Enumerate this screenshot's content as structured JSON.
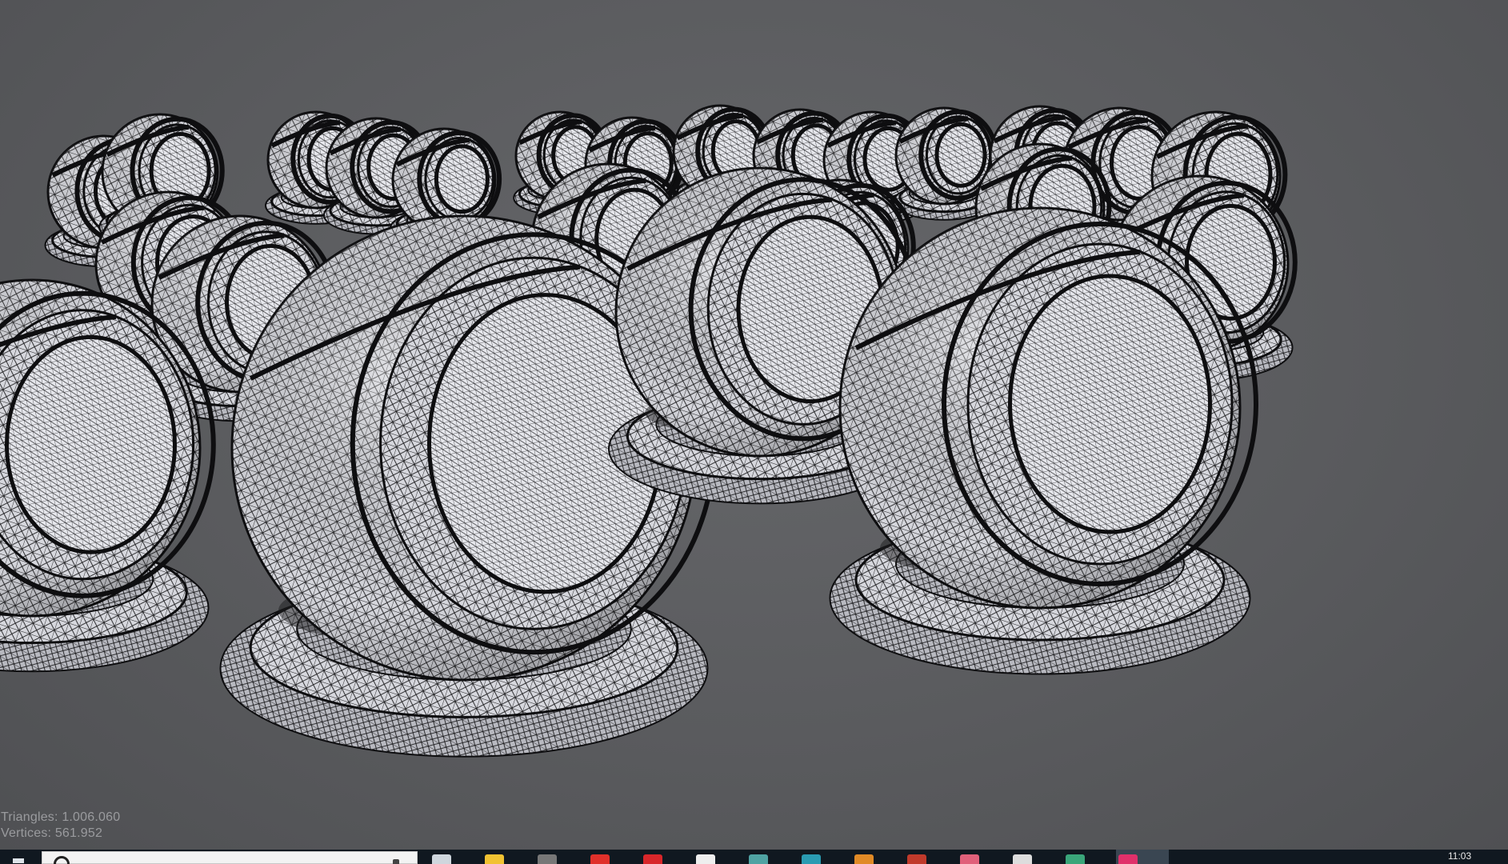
{
  "viewport": {
    "background": "#5a5b5e",
    "wire_color": "#0e0e10",
    "surface_color": "#d8d9df",
    "stats": [
      {
        "label": "Triangles",
        "value": "1.006.060"
      },
      {
        "label": "Vertices",
        "value": "561.952"
      }
    ]
  },
  "taskbar": {
    "background": "#101820",
    "start_icon": "windows-logo-icon",
    "search_icon": "search-icon",
    "mic_icon": "microphone-icon",
    "apps": [
      {
        "name": "task-view-icon",
        "color": "#cfd6dd"
      },
      {
        "name": "folder-icon",
        "color": "#f1c232"
      },
      {
        "name": "settings-icon",
        "color": "#777777"
      },
      {
        "name": "opera-icon",
        "color": "#e0302a"
      },
      {
        "name": "app-red-icon",
        "color": "#d8262a"
      },
      {
        "name": "notepad-icon",
        "color": "#eeeeee"
      },
      {
        "name": "app-teal-icon",
        "color": "#4fa3a3"
      },
      {
        "name": "app-cyan-icon",
        "color": "#2a9bb2"
      },
      {
        "name": "app-orange-icon",
        "color": "#e08a26"
      },
      {
        "name": "app-red2-icon",
        "color": "#c03a2b"
      },
      {
        "name": "app-pink-icon",
        "color": "#e0607a"
      },
      {
        "name": "file-icon",
        "color": "#dddddd"
      },
      {
        "name": "app-green-icon",
        "color": "#3aa67a"
      },
      {
        "name": "app-magenta-icon",
        "color": "#e0306a"
      }
    ],
    "clock": "11:03"
  }
}
